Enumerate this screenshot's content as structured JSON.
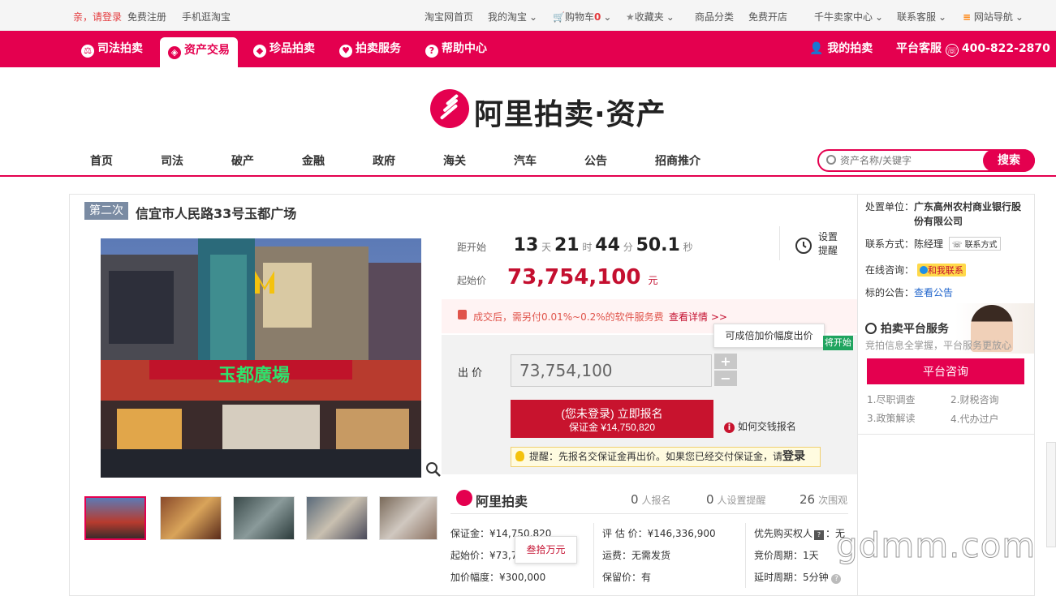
{
  "topbar": {
    "login_prefix": "亲，请登录",
    "register": "免费注册",
    "mobile": "手机逛淘宝",
    "taobao_home": "淘宝网首页",
    "my_taobao": "我的淘宝",
    "cart": "购物车",
    "cart_count": "0",
    "favorites": "收藏夹",
    "categories": "商品分类",
    "open_shop": "免费开店",
    "seller_center": "千牛卖家中心",
    "service": "联系客服",
    "site_nav": "网站导航"
  },
  "rednav": {
    "items": [
      {
        "label": "司法拍卖",
        "icon": "court-icon"
      },
      {
        "label": "资产交易",
        "icon": "asset-icon"
      },
      {
        "label": "珍品拍卖",
        "icon": "gem-icon"
      },
      {
        "label": "拍卖服务",
        "icon": "heart-icon"
      },
      {
        "label": "帮助中心",
        "icon": "help-icon"
      }
    ],
    "my_auction": "我的拍卖",
    "platform_service": "平台客服",
    "phone": "400-822-2870"
  },
  "logo": {
    "text": "阿里拍卖·资产"
  },
  "channels": [
    "首页",
    "司法",
    "破产",
    "金融",
    "政府",
    "海关",
    "汽车",
    "公告",
    "招商推介"
  ],
  "search": {
    "placeholder": "资产名称/关键字",
    "button": "搜索"
  },
  "item": {
    "round": "第二次",
    "title": "信宜市人民路33号玉都广场",
    "countdown_label": "距开始",
    "days": "13",
    "days_unit": "天",
    "hours": "21",
    "hours_unit": "时",
    "minutes": "44",
    "minutes_unit": "分",
    "seconds": "50.1",
    "seconds_unit": "秒",
    "reminder": "设置\n提醒",
    "reminder_l1": "设置",
    "reminder_l2": "提醒",
    "start_price_label": "起始价",
    "start_price": "73,754,100",
    "start_price_unit": "元",
    "fee_note": "成交后，需另付0.01%~0.2%的软件服务费",
    "fee_link": "查看详情 >>",
    "bid_label": "出 价",
    "bid_value": "73,754,100",
    "tooltip": "可成倍加价幅度出价",
    "green_tag": "将开始",
    "signup_l1": "(您未登录) 立即报名",
    "signup_l2": "保证金 ¥14,750,820",
    "how_pay": "如何交钱报名",
    "tip_text": "提醒：先报名交保证金再出价。如果您已经交付保证金，请",
    "tip_login": "登录",
    "brand": "阿里拍卖",
    "signups": "0",
    "signups_label": "人报名",
    "reminders": "0",
    "reminders_label": "人设置提醒",
    "views": "26",
    "views_label": "次围观",
    "deposit": "保证金：¥14,750,820",
    "start_price_row": "起始价：¥73,7",
    "increment": "加价幅度：¥300,000",
    "small_tip": "叁拾万元",
    "appraisal": "评 估 价：¥146,336,900",
    "shipping": "运费：无需发货",
    "reserve": "保留价：有",
    "priority": "优先购买权人",
    "priority_val": "：无",
    "cycle": "竞价周期：1天",
    "delay": "延时周期：5分钟"
  },
  "sidebar": {
    "org_label": "处置单位：",
    "org_l1": "广东高州农村商业银行股",
    "org_l2": "份有限公司",
    "contact_label": "联系方式：",
    "contact_name": "陈经理",
    "contact_btn": "联系方式",
    "online_label": "在线咨询：",
    "online_btn": "和我联系",
    "notice_label": "标的公告：",
    "notice_link": "查看公告",
    "svc_title": "拍卖平台服务",
    "svc_sub": "竞拍信息全掌握，平台服务更放心",
    "svc_button": "平台咨询",
    "svc_items": [
      "1.尽职调查",
      "2.财税咨询",
      "3.政策解读",
      "4.代办过户"
    ]
  },
  "watermark": "gdmm.com",
  "colors": {
    "brand": "#e4004f",
    "price": "#c40f2f",
    "signup": "#c8132e"
  }
}
